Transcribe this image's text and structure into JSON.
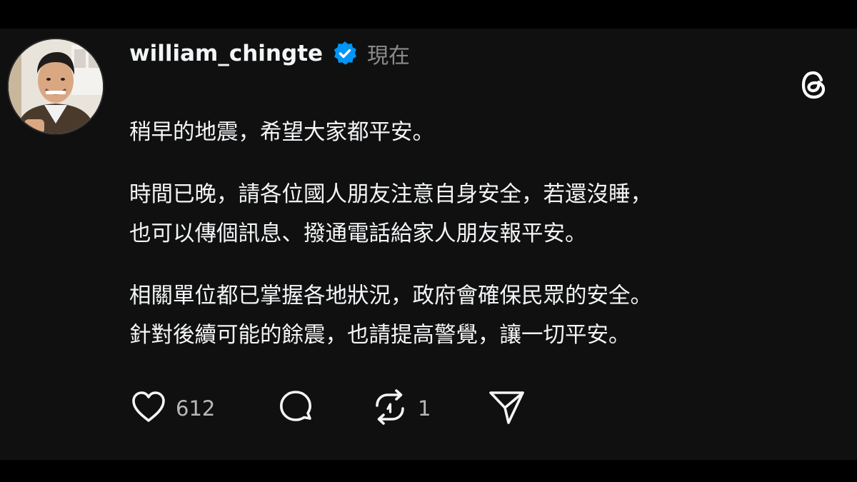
{
  "post": {
    "username": "william_chingte",
    "timestamp": "現在",
    "paragraphs": [
      [
        "稍早的地震，希望大家都平安。"
      ],
      [
        "時間已晚，請各位國人朋友注意自身安全，若還沒睡，",
        "也可以傳個訊息、撥通電話給家人朋友報平安。"
      ],
      [
        "相關單位都已掌握各地狀況，政府會確保民眾的安全。",
        "針對後續可能的餘震，也請提高警覺，讓一切平安。"
      ]
    ]
  },
  "actions": {
    "likes": "612",
    "reposts": "1"
  },
  "icons": {
    "verified": "verified-badge-icon",
    "app": "threads-logo-icon",
    "like": "heart-icon",
    "comment": "comment-bubble-icon",
    "repost": "repost-icon",
    "share": "send-icon"
  },
  "colors": {
    "background": "#101010",
    "text": "#f3f5f7",
    "muted": "#8a8a8a",
    "verified": "#0095f6"
  }
}
